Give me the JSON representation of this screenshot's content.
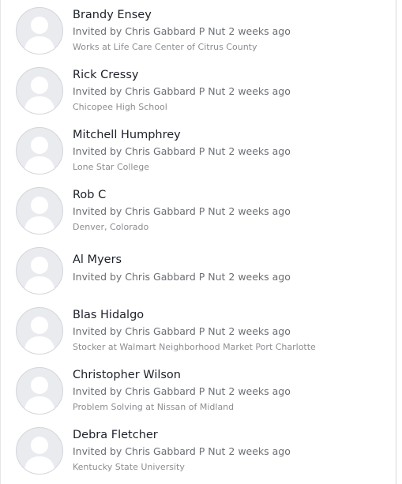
{
  "members": [
    {
      "name": "Brandy Ensey",
      "invited": "Invited by Chris Gabbard P Nut 2 weeks ago",
      "detail": "Works at Life Care Center of Citrus County"
    },
    {
      "name": "Rick Cressy",
      "invited": "Invited by Chris Gabbard P Nut 2 weeks ago",
      "detail": "Chicopee High School"
    },
    {
      "name": "Mitchell Humphrey",
      "invited": "Invited by Chris Gabbard P Nut 2 weeks ago",
      "detail": "Lone Star College"
    },
    {
      "name": "Rob C",
      "invited": "Invited by Chris Gabbard P Nut 2 weeks ago",
      "detail": "Denver, Colorado"
    },
    {
      "name": "Al Myers",
      "invited": "Invited by Chris Gabbard P Nut 2 weeks ago",
      "detail": ""
    },
    {
      "name": "Blas Hidalgo",
      "invited": "Invited by Chris Gabbard P Nut 2 weeks ago",
      "detail": "Stocker at Walmart Neighborhood Market Port Charlotte"
    },
    {
      "name": "Christopher Wilson",
      "invited": "Invited by Chris Gabbard P Nut 2 weeks ago",
      "detail": "Problem Solving at Nissan of Midland"
    },
    {
      "name": "Debra Fletcher",
      "invited": "Invited by Chris Gabbard P Nut 2 weeks ago",
      "detail": "Kentucky State University"
    }
  ],
  "avatar_icon": "default-user-silhouette-icon",
  "colors": {
    "avatar_bg": "#e9ebee",
    "silhouette": "#ffffff",
    "name_text": "#1d2129",
    "meta_text": "#6a6e74"
  }
}
